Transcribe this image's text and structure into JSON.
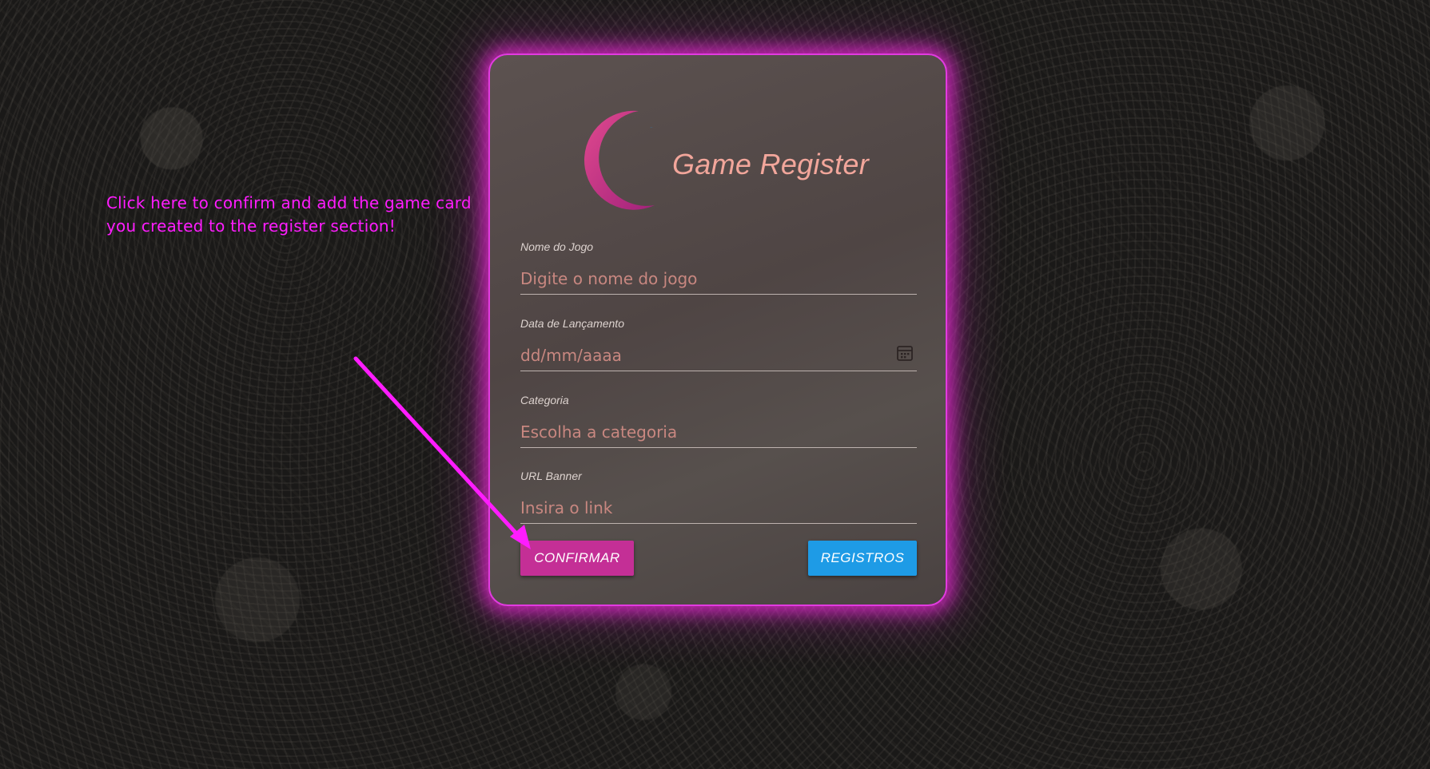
{
  "annotation": {
    "text": "Click here to confirm and add the game card you created to the register section!"
  },
  "app": {
    "title": "Game Register"
  },
  "form": {
    "fields": [
      {
        "label": "Nome do Jogo",
        "placeholder": "Digite o nome do jogo",
        "value": ""
      },
      {
        "label": "Data de Lançamento",
        "placeholder": "dd/mm/aaaa",
        "value": ""
      },
      {
        "label": "Categoria",
        "placeholder": "Escolha a categoria",
        "value": ""
      },
      {
        "label": "URL Banner",
        "placeholder": "Insira o link",
        "value": ""
      }
    ],
    "confirm_label": "CONFIRMAR",
    "registros_label": "REGISTROS"
  },
  "icons": {
    "logo": "crescent-logo-icon",
    "calendar": "calendar-icon",
    "annotation_arrow": "arrow-icon"
  },
  "colors": {
    "accent_pink": "#c42f96",
    "accent_blue": "#1e9be6",
    "glow": "#e23be0",
    "annotation": "#ff1cff",
    "title": "#f2a69b"
  }
}
